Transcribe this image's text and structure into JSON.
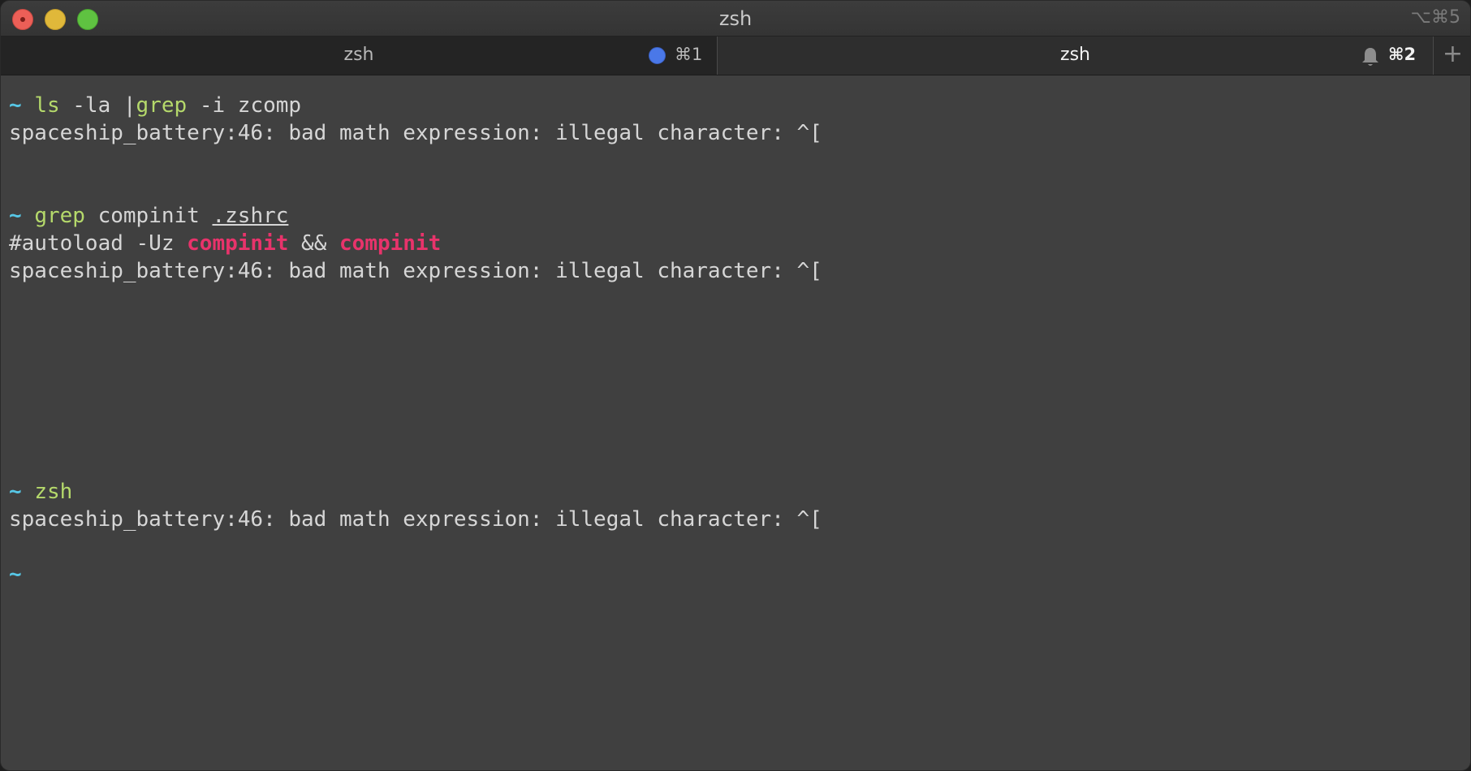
{
  "window": {
    "title": "zsh",
    "shortcut": "⌥⌘5"
  },
  "tabs": [
    {
      "label": "zsh",
      "shortcut": "⌘1",
      "indicator": "blue-dot"
    },
    {
      "label": "zsh",
      "shortcut": "⌘2",
      "indicator": "bell-icon"
    }
  ],
  "new_tab_label": "+",
  "colors": {
    "prompt": "#57c7e6",
    "command": "#b5d96b",
    "match_highlight": "#e8336b",
    "text": "#d6d6d6",
    "background": "#404040"
  },
  "terminal": {
    "block1": {
      "prompt": "~",
      "cmd1": "ls",
      "args1": " -la |",
      "cmd2": "grep",
      "args2": " -i zcomp",
      "output": "spaceship_battery:46: bad math expression: illegal character: ^["
    },
    "block2": {
      "prompt": "~",
      "cmd": "grep",
      "args": " compinit ",
      "file": ".zshrc",
      "out_prefix": "#autoload -Uz ",
      "match1": "compinit",
      "out_mid": " && ",
      "match2": "compinit",
      "output": "spaceship_battery:46: bad math expression: illegal character: ^["
    },
    "block3": {
      "prompt": "~",
      "cmd": "zsh",
      "output": "spaceship_battery:46: bad math expression: illegal character: ^["
    },
    "block4": {
      "prompt": "~"
    }
  }
}
